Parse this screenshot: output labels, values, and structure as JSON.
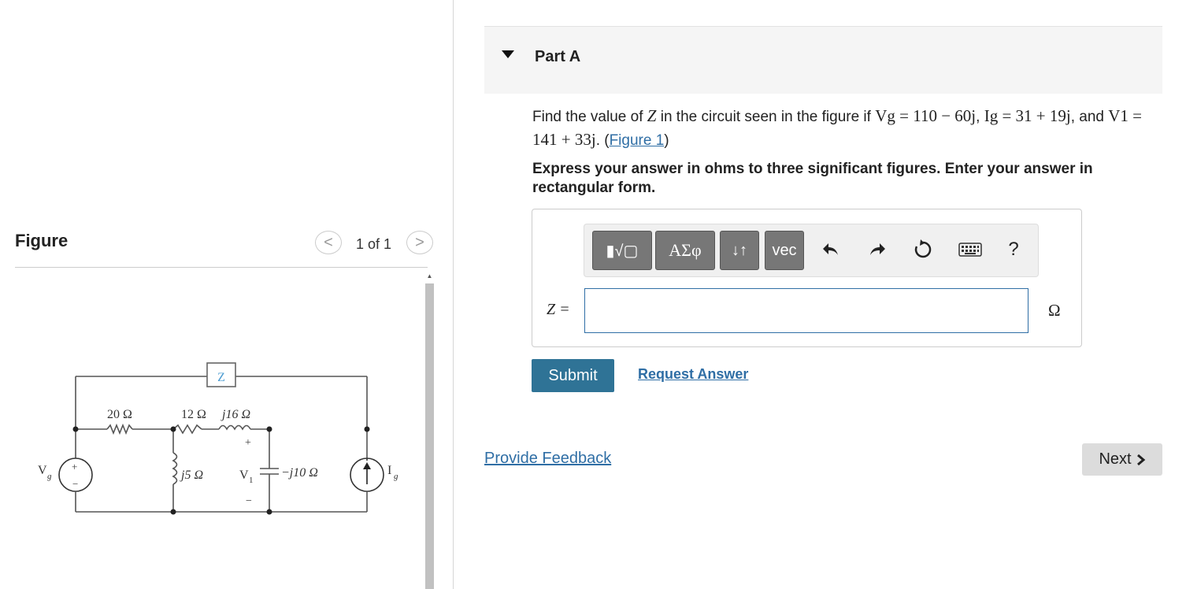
{
  "figure_panel": {
    "title": "Figure",
    "pager_text": "1 of 1",
    "prev_symbol": "<",
    "next_symbol": ">",
    "circuit": {
      "z_label": "Z",
      "r1": "20 Ω",
      "r2": "12 Ω",
      "l1": "j16 Ω",
      "l2": "j5 Ω",
      "cap": "−j10 Ω",
      "vg": "V",
      "vg_sub": "g",
      "v1": "V",
      "v1_sub": "1",
      "ig": "I",
      "ig_sub": "g",
      "plus": "+",
      "minus": "−"
    }
  },
  "part": {
    "title": "Part A"
  },
  "question": {
    "intro": "Find the value of ",
    "z": "Z",
    "mid1": " in the circuit seen in the figure if ",
    "vg_expr": "Vg = 110 − 60j",
    "sep1": ", ",
    "ig_expr": "Ig = 31 + 19j",
    "mid2": ", and ",
    "v1_expr": "V1 = 141 + 33j",
    "end": ". (",
    "figure_link": "Figure 1",
    "close": ")"
  },
  "instruction": "Express your answer in ohms to three significant figures. Enter your answer in rectangular form.",
  "answer": {
    "label": "Z =",
    "value": "",
    "unit": "Ω",
    "toolbar": {
      "templates": "▮√▢",
      "symbols": "ΑΣφ",
      "sort": "↓↑",
      "vec": "vec",
      "help": "?"
    }
  },
  "actions": {
    "submit": "Submit",
    "request": "Request Answer",
    "feedback": "Provide Feedback",
    "next": "Next"
  }
}
